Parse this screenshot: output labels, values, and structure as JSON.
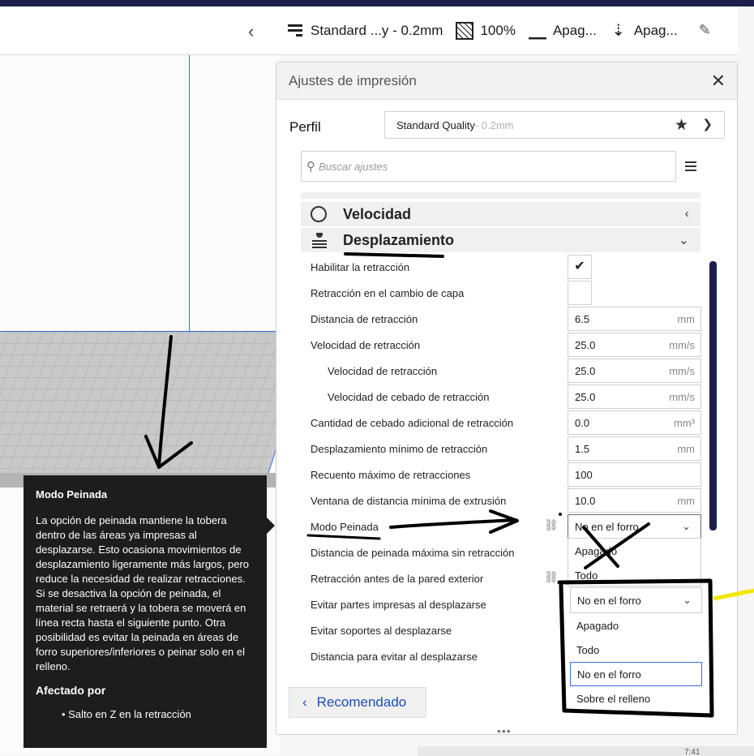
{
  "header": {
    "profile_summary": "Standard ...y - 0.2mm",
    "infill": "100%",
    "support": "Apag...",
    "adhesion": "Apag..."
  },
  "panel": {
    "title": "Ajustes de impresión",
    "profile_label": "Perfil",
    "profile_name": "Standard Quality",
    "profile_sub": " - 0.2mm",
    "search_placeholder": "Buscar ajustes"
  },
  "categories": {
    "velocidad": "Velocidad",
    "desplazamiento": "Desplazamiento"
  },
  "settings": [
    {
      "label": "Habilitar la retracción",
      "value": "",
      "unit": ""
    },
    {
      "label": "Retracción en el cambio de capa",
      "value": "",
      "unit": ""
    },
    {
      "label": "Distancia de retracción",
      "value": "6.5",
      "unit": "mm"
    },
    {
      "label": "Velocidad de retracción",
      "value": "25.0",
      "unit": "mm/s"
    },
    {
      "label": "Velocidad de retracción",
      "value": "25.0",
      "unit": "mm/s"
    },
    {
      "label": "Velocidad de cebado de retracción",
      "value": "25.0",
      "unit": "mm/s"
    },
    {
      "label": "Cantidad de cebado adicional de retracción",
      "value": "0.0",
      "unit": "mm³"
    },
    {
      "label": "Desplazamiento mínimo de retracción",
      "value": "1.5",
      "unit": "mm"
    },
    {
      "label": "Recuento máximo de retracciones",
      "value": "100",
      "unit": ""
    },
    {
      "label": "Ventana de distancia mínima de extrusión",
      "value": "10.0",
      "unit": "mm"
    },
    {
      "label": "Modo Peinada",
      "value": "No en el forro",
      "unit": ""
    },
    {
      "label": "Distancia de peinada máxima sin retracción",
      "value": "",
      "unit": ""
    },
    {
      "label": "Retracción antes de la pared exterior",
      "value": "",
      "unit": ""
    },
    {
      "label": "Evitar partes impresas al desplazarse",
      "value": "",
      "unit": ""
    },
    {
      "label": "Evitar soportes al desplazarse",
      "value": "",
      "unit": ""
    },
    {
      "label": "Distancia para evitar al desplazarse",
      "value": "",
      "unit": ""
    }
  ],
  "small_dropdown_options": [
    "Apagado",
    "Todo"
  ],
  "big_dropdown": {
    "selected": "No en el forro",
    "options": [
      "Apagado",
      "Todo",
      "No en el forro",
      "Sobre el relleno"
    ]
  },
  "footer": {
    "recommended": "Recomendado"
  },
  "tooltip": {
    "title": "Modo Peinada",
    "body": "La opción de peinada mantiene la tobera dentro de las áreas ya impresas al desplazarse. Esto ocasiona movimientos de desplazamiento ligeramente más largos, pero reduce la necesidad de realizar retracciones. Si se desactiva la opción de peinada, el material se retraerá y la tobera se moverá en línea recta hasta el siguiente punto. Otra posibilidad es evitar la peinada en áreas de forro superiores/inferiores o peinar solo en el relleno.",
    "affected_title": "Afectado por",
    "affected_item": "• Salto en Z en la retracción"
  },
  "statusbar": {
    "text": "7:41"
  }
}
